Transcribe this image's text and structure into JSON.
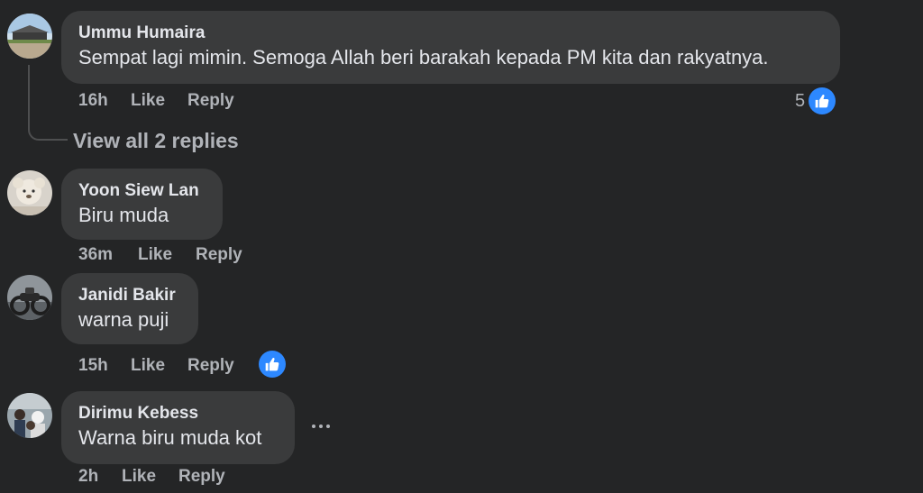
{
  "comments": [
    {
      "author": "Ummu Humaira",
      "text": "Sempat lagi mimin. Semoga Allah beri barakah kepada PM kita dan rakyatnya.",
      "time": "16h",
      "like_label": "Like",
      "reply_label": "Reply",
      "reaction_count": "5",
      "reaction_icon": "thumbs-up-icon",
      "view_replies_label": "View all 2 replies"
    },
    {
      "author": "Yoon Siew Lan",
      "text": "Biru muda",
      "time": "36m",
      "like_label": "Like",
      "reply_label": "Reply"
    },
    {
      "author": "Janidi Bakir",
      "text": "warna puji",
      "time": "15h",
      "like_label": "Like",
      "reply_label": "Reply",
      "reaction_icon": "thumbs-up-icon"
    },
    {
      "author": "Dirimu Kebess",
      "text": "Warna biru muda kot",
      "time": "2h",
      "like_label": "Like",
      "reply_label": "Reply",
      "more_icon": "more-horizontal-icon"
    }
  ],
  "colors": {
    "background": "#242526",
    "bubble": "#3a3b3c",
    "primary_text": "#e4e6eb",
    "secondary_text": "#b0b3b8",
    "like_blue": "#2d88ff"
  }
}
